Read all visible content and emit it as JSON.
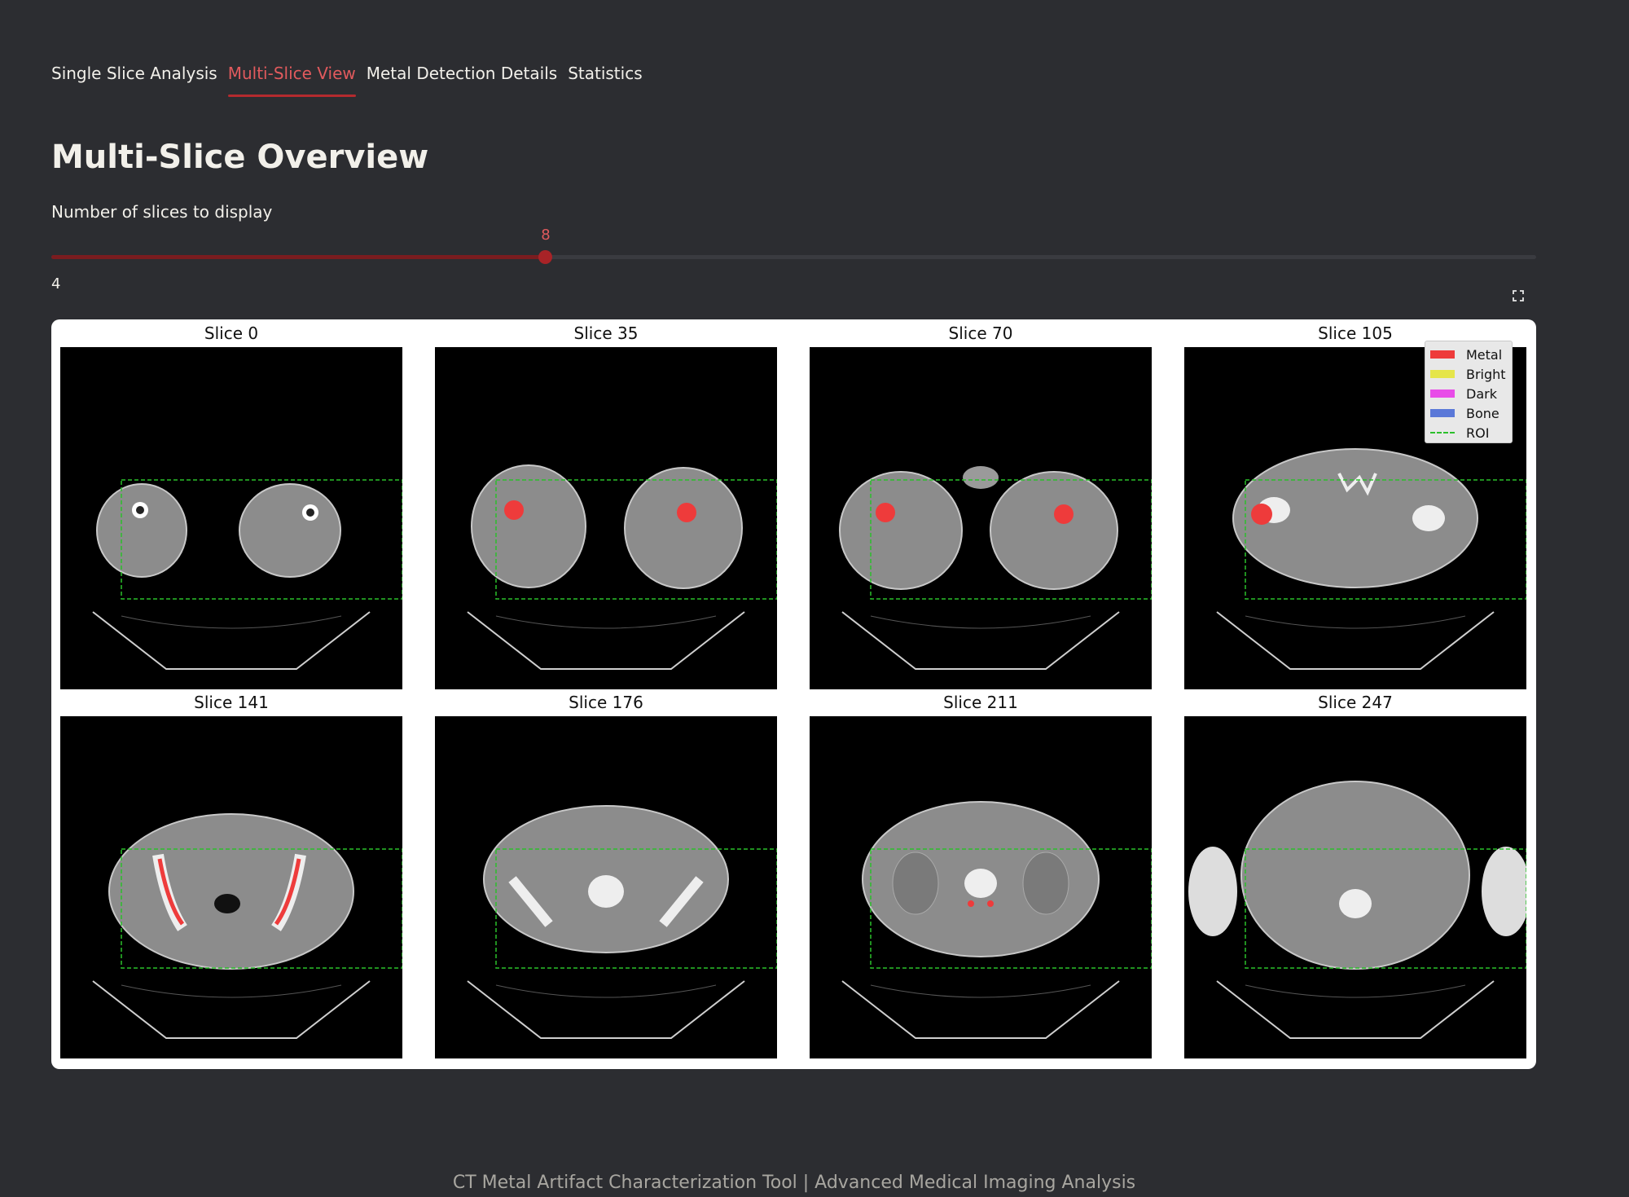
{
  "tabs": [
    {
      "label": "Single Slice Analysis",
      "active": false
    },
    {
      "label": "Multi-Slice View",
      "active": true
    },
    {
      "label": "Metal Detection Details",
      "active": false
    },
    {
      "label": "Statistics",
      "active": false
    }
  ],
  "page_title": "Multi-Slice Overview",
  "slider": {
    "label": "Number of slices to display",
    "value": "8",
    "min_label": "4",
    "fill_fraction": 0.333
  },
  "figure": {
    "panels": [
      {
        "title": "Slice 0",
        "icon": "ct-scan-image"
      },
      {
        "title": "Slice 35",
        "icon": "ct-scan-image"
      },
      {
        "title": "Slice 70",
        "icon": "ct-scan-image"
      },
      {
        "title": "Slice 105",
        "icon": "ct-scan-image"
      },
      {
        "title": "Slice 141",
        "icon": "ct-scan-image"
      },
      {
        "title": "Slice 176",
        "icon": "ct-scan-image"
      },
      {
        "title": "Slice 211",
        "icon": "ct-scan-image"
      },
      {
        "title": "Slice 247",
        "icon": "ct-scan-image"
      }
    ],
    "legend": [
      {
        "label": "Metal",
        "color": "#ee3b3b",
        "style": "solid"
      },
      {
        "label": "Bright",
        "color": "#e5e54a",
        "style": "solid"
      },
      {
        "label": "Dark",
        "color": "#e84ce8",
        "style": "solid"
      },
      {
        "label": "Bone",
        "color": "#5a78d8",
        "style": "solid"
      },
      {
        "label": "ROI",
        "color": "#2bbf2b",
        "style": "dashed"
      }
    ]
  },
  "colors": {
    "background": "#2c2d31",
    "accent": "#e15a5d",
    "metal": "#ee3b3b",
    "roi": "#2bbf2b"
  },
  "footer": "CT Metal Artifact Characterization Tool | Advanced Medical Imaging Analysis"
}
